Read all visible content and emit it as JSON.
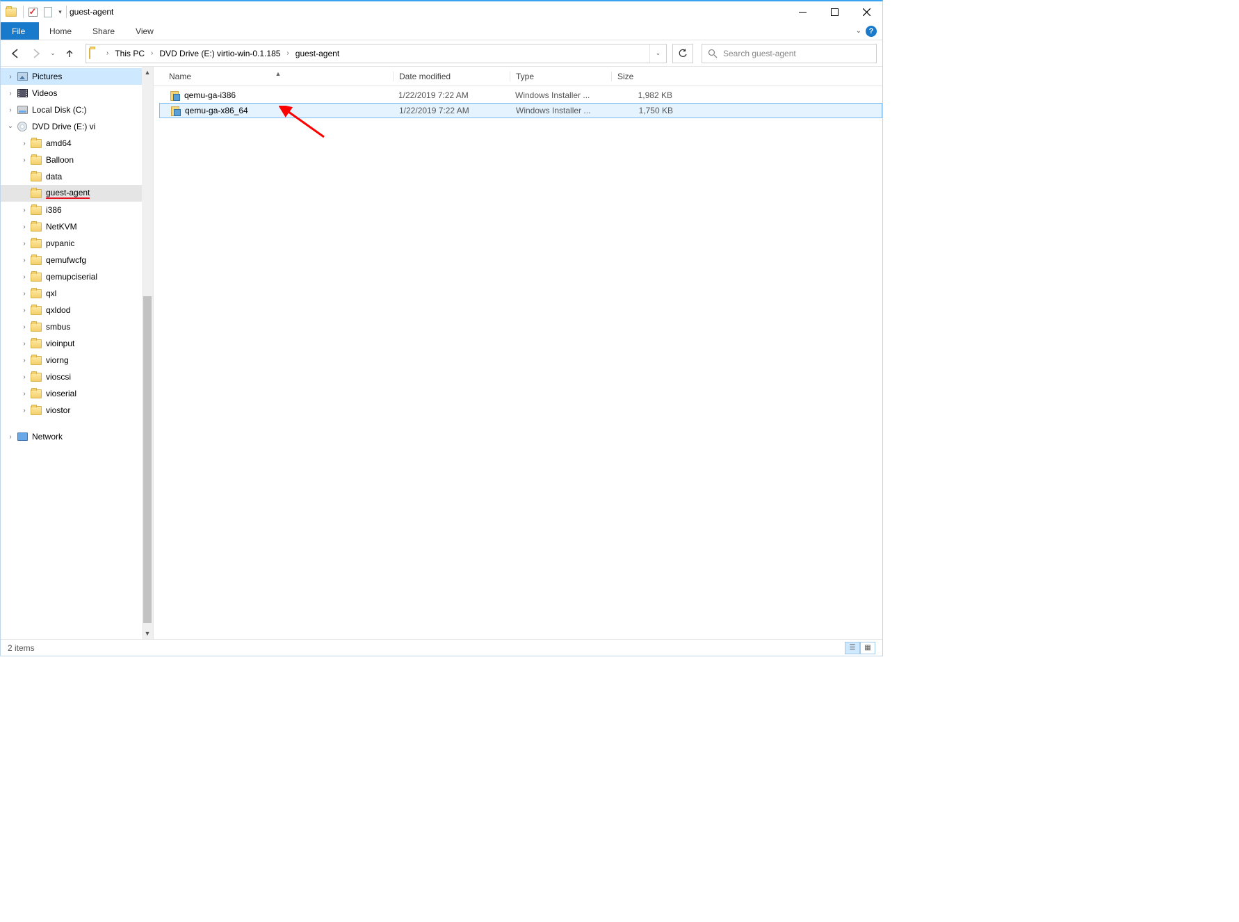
{
  "window": {
    "title": "guest-agent"
  },
  "ribbon": {
    "file": "File",
    "tabs": [
      "Home",
      "Share",
      "View"
    ]
  },
  "breadcrumbs": [
    "This PC",
    "DVD Drive (E:) virtio-win-0.1.185",
    "guest-agent"
  ],
  "search": {
    "placeholder": "Search guest-agent"
  },
  "columns": {
    "name": "Name",
    "date": "Date modified",
    "type": "Type",
    "size": "Size"
  },
  "tree": [
    {
      "label": "Pictures",
      "icon": "picture",
      "indent": 0,
      "exp": ">"
    },
    {
      "label": "Videos",
      "icon": "video",
      "indent": 0,
      "exp": ">"
    },
    {
      "label": "Local Disk (C:)",
      "icon": "disk",
      "indent": 0,
      "exp": ">"
    },
    {
      "label": "DVD Drive (E:) vi",
      "icon": "dvd",
      "indent": 0,
      "exp": "v"
    },
    {
      "label": "amd64",
      "icon": "folder",
      "indent": 1,
      "exp": ">"
    },
    {
      "label": "Balloon",
      "icon": "folder",
      "indent": 1,
      "exp": ">"
    },
    {
      "label": "data",
      "icon": "folder",
      "indent": 1,
      "exp": ""
    },
    {
      "label": "guest-agent",
      "icon": "folder",
      "indent": 1,
      "exp": "",
      "current": true,
      "underline": true
    },
    {
      "label": "i386",
      "icon": "folder",
      "indent": 1,
      "exp": ">"
    },
    {
      "label": "NetKVM",
      "icon": "folder",
      "indent": 1,
      "exp": ">"
    },
    {
      "label": "pvpanic",
      "icon": "folder",
      "indent": 1,
      "exp": ">"
    },
    {
      "label": "qemufwcfg",
      "icon": "folder",
      "indent": 1,
      "exp": ">"
    },
    {
      "label": "qemupciserial",
      "icon": "folder",
      "indent": 1,
      "exp": ">"
    },
    {
      "label": "qxl",
      "icon": "folder",
      "indent": 1,
      "exp": ">"
    },
    {
      "label": "qxldod",
      "icon": "folder",
      "indent": 1,
      "exp": ">"
    },
    {
      "label": "smbus",
      "icon": "folder",
      "indent": 1,
      "exp": ">"
    },
    {
      "label": "vioinput",
      "icon": "folder",
      "indent": 1,
      "exp": ">"
    },
    {
      "label": "viorng",
      "icon": "folder",
      "indent": 1,
      "exp": ">"
    },
    {
      "label": "vioscsi",
      "icon": "folder",
      "indent": 1,
      "exp": ">"
    },
    {
      "label": "vioserial",
      "icon": "folder",
      "indent": 1,
      "exp": ">"
    },
    {
      "label": "viostor",
      "icon": "folder",
      "indent": 1,
      "exp": ">"
    },
    {
      "label": "",
      "icon": "",
      "indent": 0,
      "exp": "",
      "spacer": true
    },
    {
      "label": "Network",
      "icon": "network",
      "indent": -1,
      "exp": ">"
    }
  ],
  "files": [
    {
      "name": "qemu-ga-i386",
      "date": "1/22/2019 7:22 AM",
      "type": "Windows Installer ...",
      "size": "1,982 KB",
      "selected": false
    },
    {
      "name": "qemu-ga-x86_64",
      "date": "1/22/2019 7:22 AM",
      "type": "Windows Installer ...",
      "size": "1,750 KB",
      "selected": true
    }
  ],
  "status": {
    "text": "2 items"
  }
}
